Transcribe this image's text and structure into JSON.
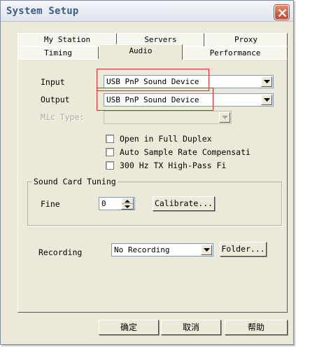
{
  "window": {
    "title": "System Setup"
  },
  "tabs": {
    "row1": [
      "My Station",
      "Servers",
      "Proxy"
    ],
    "row2": [
      "Timing",
      "Audio",
      "Performance"
    ],
    "selected": "Audio"
  },
  "audio": {
    "input_label": "Input",
    "input_value": "USB PnP Sound Device",
    "output_label": "Output",
    "output_value": "USB PnP Sound Device",
    "mic_type_label": "Mic Type:",
    "mic_type_value": "",
    "checkboxes": [
      {
        "label": "Open in Full Duplex",
        "checked": false
      },
      {
        "label": "Auto Sample Rate Compensati",
        "checked": false
      },
      {
        "label": "300 Hz TX High-Pass Fi",
        "checked": false
      }
    ]
  },
  "tuning": {
    "group_title": "Sound Card Tuning",
    "fine_label": "Fine",
    "fine_value": "0",
    "calibrate_button": "Calibrate..."
  },
  "recording": {
    "label": "Recording",
    "value": "No Recording",
    "folder_button": "Folder..."
  },
  "footer": {
    "ok_button": "确定",
    "cancel_button": "取消",
    "help_button": "帮助"
  },
  "colors": {
    "dialog_bg": "#ece9d8",
    "title_text": "#3d5c88",
    "close_button": "#c0472a",
    "highlight_box": "#cf2f2f"
  }
}
